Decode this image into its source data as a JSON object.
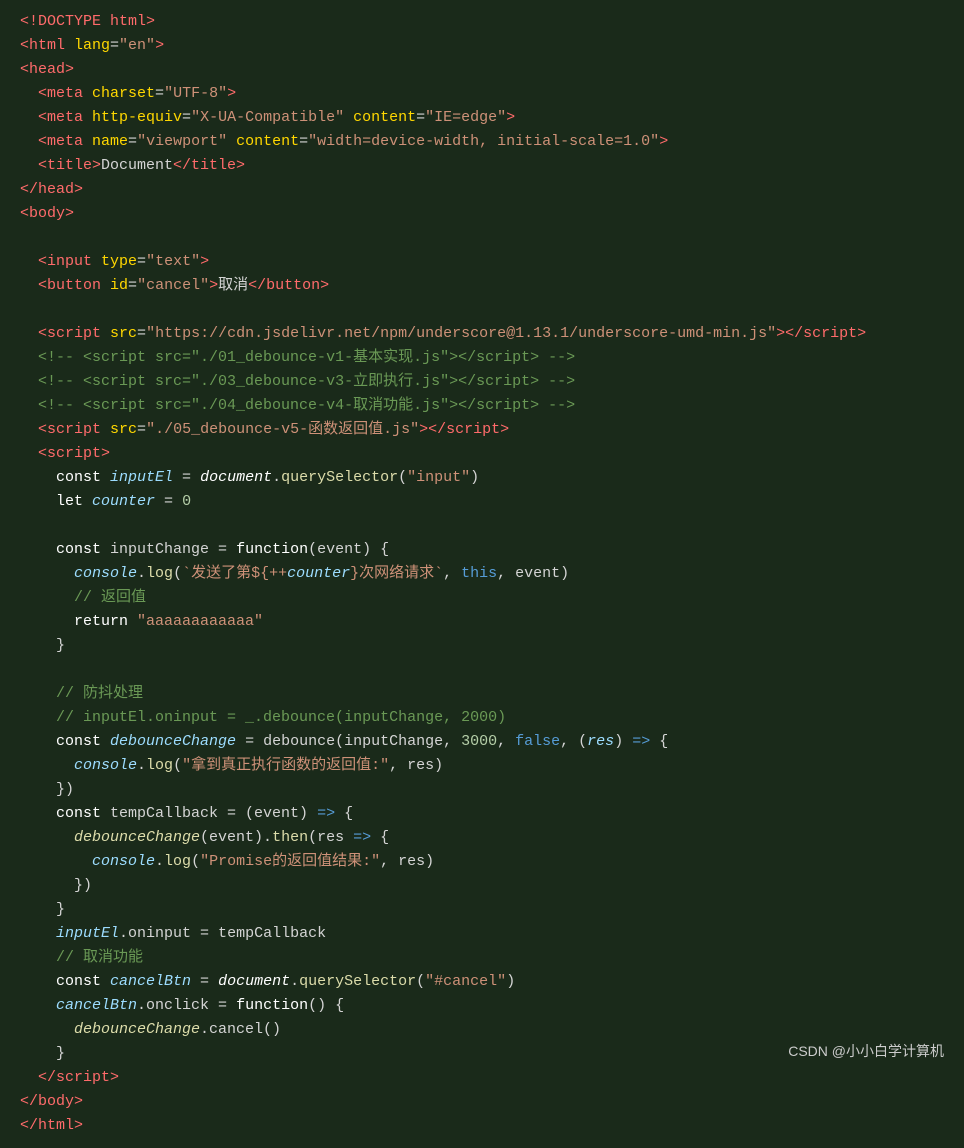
{
  "watermark": "CSDN @小小白学计算机",
  "code": {
    "lines": [
      {
        "id": 1,
        "content": "doctype"
      },
      {
        "id": 2,
        "content": "html_open"
      },
      {
        "id": 3,
        "content": "head_open"
      },
      {
        "id": 4,
        "content": "meta_charset"
      },
      {
        "id": 5,
        "content": "meta_http"
      },
      {
        "id": 6,
        "content": "meta_viewport"
      },
      {
        "id": 7,
        "content": "title"
      },
      {
        "id": 8,
        "content": "head_close"
      },
      {
        "id": 9,
        "content": "body_open"
      },
      {
        "id": 10,
        "content": "blank"
      },
      {
        "id": 11,
        "content": "input"
      },
      {
        "id": 12,
        "content": "button"
      },
      {
        "id": 13,
        "content": "blank"
      },
      {
        "id": 14,
        "content": "script_cdn"
      },
      {
        "id": 15,
        "content": "comment1"
      },
      {
        "id": 16,
        "content": "comment2"
      },
      {
        "id": 17,
        "content": "comment3"
      },
      {
        "id": 18,
        "content": "script_v5"
      },
      {
        "id": 19,
        "content": "script_open"
      },
      {
        "id": 20,
        "content": "const_inputEl"
      },
      {
        "id": 21,
        "content": "let_counter"
      },
      {
        "id": 22,
        "content": "blank"
      },
      {
        "id": 23,
        "content": "const_inputChange"
      },
      {
        "id": 24,
        "content": "console_log_template"
      },
      {
        "id": 25,
        "content": "comment_return"
      },
      {
        "id": 26,
        "content": "return_aaa"
      },
      {
        "id": 27,
        "content": "close_brace"
      },
      {
        "id": 28,
        "content": "blank"
      },
      {
        "id": 29,
        "content": "comment_fangdou"
      },
      {
        "id": 30,
        "content": "comment_inputEl"
      },
      {
        "id": 31,
        "content": "const_debounceChange"
      },
      {
        "id": 32,
        "content": "console_log_nazhen"
      },
      {
        "id": 33,
        "content": "close_brace_paren"
      },
      {
        "id": 34,
        "content": "const_tempCallback"
      },
      {
        "id": 35,
        "content": "debounceChange_then"
      },
      {
        "id": 36,
        "content": "console_log_promise"
      },
      {
        "id": 37,
        "content": "close_brace_paren2"
      },
      {
        "id": 38,
        "content": "close_brace2"
      },
      {
        "id": 39,
        "content": "inputEl_oninput"
      },
      {
        "id": 40,
        "content": "comment_cancel"
      },
      {
        "id": 41,
        "content": "const_cancelBtn"
      },
      {
        "id": 42,
        "content": "cancelBtn_onclick"
      },
      {
        "id": 43,
        "content": "debounceChange_cancel"
      },
      {
        "id": 44,
        "content": "close_brace3"
      },
      {
        "id": 45,
        "content": "script_close"
      },
      {
        "id": 46,
        "content": "body_close"
      },
      {
        "id": 47,
        "content": "html_close"
      }
    ]
  }
}
